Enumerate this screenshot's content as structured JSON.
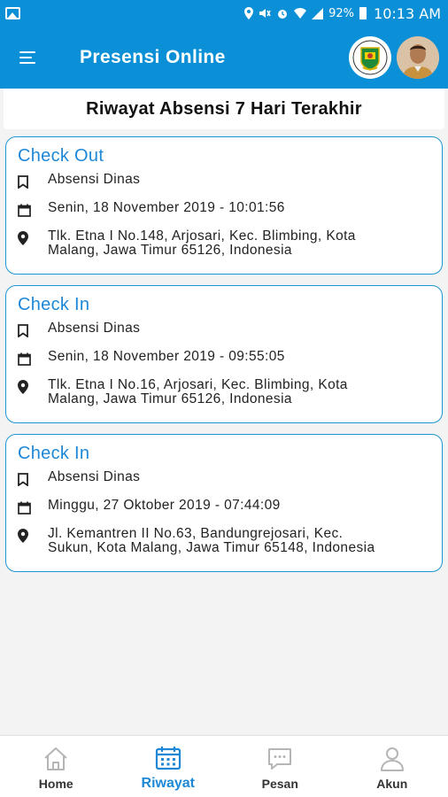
{
  "status_bar": {
    "battery": "92%",
    "time": "10:13 AM"
  },
  "app_bar": {
    "title": "Presensi Online"
  },
  "section": {
    "title": "Riwayat Absensi 7 Hari Terakhir"
  },
  "records": [
    {
      "type": "Check Out",
      "category": "Absensi Dinas",
      "datetime": "Senin, 18 November 2019 - 10:01:56",
      "address_line1": "Tlk. Etna I No.148, Arjosari, Kec. Blimbing, Kota",
      "address_line2": "Malang, Jawa Timur 65126, Indonesia"
    },
    {
      "type": "Check In",
      "category": "Absensi Dinas",
      "datetime": "Senin, 18 November 2019 - 09:55:05",
      "address_line1": "Tlk. Etna I No.16, Arjosari, Kec. Blimbing, Kota",
      "address_line2": "Malang, Jawa Timur 65126, Indonesia"
    },
    {
      "type": "Check In",
      "category": "Absensi Dinas",
      "datetime": "Minggu, 27 Oktober 2019 - 07:44:09",
      "address_line1": "Jl. Kemantren II No.63, Bandungrejosari, Kec.",
      "address_line2": "Sukun, Kota Malang, Jawa Timur 65148, Indonesia"
    }
  ],
  "bottom_nav": {
    "items": [
      {
        "label": "Home",
        "icon": "home-icon"
      },
      {
        "label": "Riwayat",
        "icon": "calendar-icon",
        "active": true
      },
      {
        "label": "Pesan",
        "icon": "chat-icon"
      },
      {
        "label": "Akun",
        "icon": "user-icon"
      }
    ]
  },
  "colors": {
    "primary": "#0b8fd6",
    "accent": "#1e88d6",
    "card_border": "#1e95d7",
    "inactive_icon": "#b5b5b5"
  }
}
